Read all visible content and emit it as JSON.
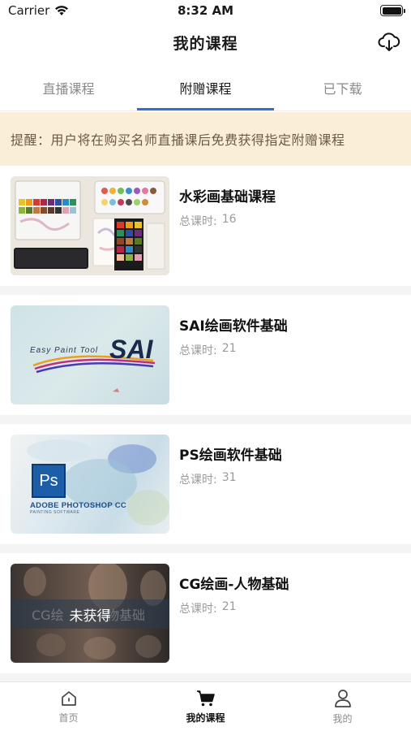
{
  "status_bar": {
    "carrier": "Carrier",
    "time": "8:32 AM"
  },
  "nav": {
    "title": "我的课程",
    "download_icon": "cloud-download-icon"
  },
  "tabs": [
    {
      "label": "直播课程",
      "active": false
    },
    {
      "label": "附赠课程",
      "active": true
    },
    {
      "label": "已下载",
      "active": false
    }
  ],
  "notice": {
    "text": "提醒：用户将在购买名师直播课后免费获得指定附赠课程"
  },
  "courses": [
    {
      "title": "水彩画基础课程",
      "hours_label": "总课时:",
      "hours": "16"
    },
    {
      "title": "SAI绘画软件基础",
      "hours_label": "总课时:",
      "hours": "21",
      "thumb_text_small": "Easy Paint Tool",
      "thumb_text_big": "SAI"
    },
    {
      "title": "PS绘画软件基础",
      "hours_label": "总课时:",
      "hours": "31",
      "thumb_logo": "Ps",
      "thumb_text": "ADOBE PHOTOSHOP CC",
      "thumb_subtext": "PAINTING SOFTWARE"
    },
    {
      "title": "CG绘画-人物基础",
      "hours_label": "总课时:",
      "hours": "21",
      "thumb_ghost_left": "CG绘",
      "thumb_ghost_right": "物基础",
      "thumb_status": "未获得"
    }
  ],
  "bottom_nav": [
    {
      "label": "首页",
      "icon": "home-icon",
      "active": false
    },
    {
      "label": "我的课程",
      "icon": "cart-icon",
      "active": true
    },
    {
      "label": "我的",
      "icon": "person-icon",
      "active": false
    }
  ],
  "colors": {
    "accent": "#2f6fd6",
    "notice_bg": "#fbeed9",
    "notice_text": "#6a5a44"
  }
}
